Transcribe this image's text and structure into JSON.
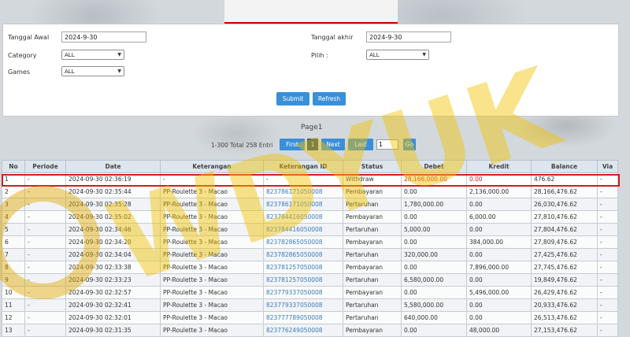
{
  "filters": {
    "tanggal_awal_label": "Tanggal Awal",
    "tanggal_awal_value": "2024-9-30",
    "tanggal_akhir_label": "Tanggal akhir",
    "tanggal_akhir_value": "2024-9-30",
    "category_label": "Category",
    "category_value": "ALL",
    "pilih_label": "Pilih :",
    "pilih_value": "ALL",
    "games_label": "Games",
    "games_value": "ALL",
    "submit_label": "Submit",
    "refresh_label": "Refresh"
  },
  "pager": {
    "title": "Page1",
    "info": "1-300 Total 258 Entri",
    "first_label": "First",
    "current_page": "1",
    "next_label": "Next",
    "last_label": "Last",
    "page_input": "1",
    "go_label": "Go"
  },
  "table": {
    "headers": [
      "No",
      "Periode",
      "Date",
      "Keterangan",
      "Keterangan ID",
      "Status",
      "Debet",
      "Kredit",
      "Balance",
      "Via"
    ],
    "rows": [
      [
        "1",
        "-",
        "2024-09-30 02:36:19",
        "-",
        "-",
        "Withdraw",
        "28,166,000.00",
        "0.00",
        "476.62",
        "-"
      ],
      [
        "2",
        "-",
        "2024-09-30 02:35:44",
        "PP-Roulette 3 - Macao",
        "823786171050008",
        "Pembayaran",
        "0.00",
        "2,136,000.00",
        "28,166,476.62",
        "-"
      ],
      [
        "3",
        "-",
        "2024-09-30 02:35:28",
        "PP-Roulette 3 - Macao",
        "823786171050008",
        "Pertaruhan",
        "1,780,000.00",
        "0.00",
        "26,030,476.62",
        "-"
      ],
      [
        "4",
        "-",
        "2024-09-30 02:35:02",
        "PP-Roulette 3 - Macao",
        "823784416050008",
        "Pembayaran",
        "0.00",
        "6,000.00",
        "27,810,476.62",
        "-"
      ],
      [
        "5",
        "-",
        "2024-09-30 02:34:46",
        "PP-Roulette 3 - Macao",
        "823784416050008",
        "Pertaruhan",
        "5,000.00",
        "0.00",
        "27,804,476.62",
        "-"
      ],
      [
        "6",
        "-",
        "2024-09-30 02:34:20",
        "PP-Roulette 3 - Macao",
        "823782865050008",
        "Pembayaran",
        "0.00",
        "384,000.00",
        "27,809,476.62",
        "-"
      ],
      [
        "7",
        "-",
        "2024-09-30 02:34:04",
        "PP-Roulette 3 - Macao",
        "823782865050008",
        "Pertaruhan",
        "320,000.00",
        "0.00",
        "27,425,476.62",
        "-"
      ],
      [
        "8",
        "-",
        "2024-09-30 02:33:38",
        "PP-Roulette 3 - Macao",
        "823781257050008",
        "Pembayaran",
        "0.00",
        "7,896,000.00",
        "27,745,476.62",
        "-"
      ],
      [
        "9",
        "-",
        "2024-09-30 02:33:23",
        "PP-Roulette 3 - Macao",
        "823781257050008",
        "Pertaruhan",
        "6,580,000.00",
        "0.00",
        "19,849,476.62",
        "-"
      ],
      [
        "10",
        "-",
        "2024-09-30 02:32:57",
        "PP-Roulette 3 - Macao",
        "823779337050008",
        "Pembayaran",
        "0.00",
        "5,496,000.00",
        "26,429,476.62",
        "-"
      ],
      [
        "11",
        "-",
        "2024-09-30 02:32:41",
        "PP-Roulette 3 - Macao",
        "823779337050008",
        "Pertaruhan",
        "5,580,000.00",
        "0.00",
        "20,933,476.62",
        "-"
      ],
      [
        "12",
        "-",
        "2024-09-30 02:32:01",
        "PP-Roulette 3 - Macao",
        "823777789050008",
        "Pertaruhan",
        "640,000.00",
        "0.00",
        "26,513,476.62",
        "-"
      ],
      [
        "13",
        "-",
        "2024-09-30 02:31:35",
        "PP-Roulette 3 - Macao",
        "823776249050008",
        "Pembayaran",
        "0.00",
        "48,000.00",
        "27,153,476.62",
        "-"
      ]
    ]
  },
  "colors": {
    "accent": "#3a8fd8",
    "highlight_border": "#d11d1d",
    "link": "#3b7dbf"
  },
  "watermark_text": "WDYUK"
}
